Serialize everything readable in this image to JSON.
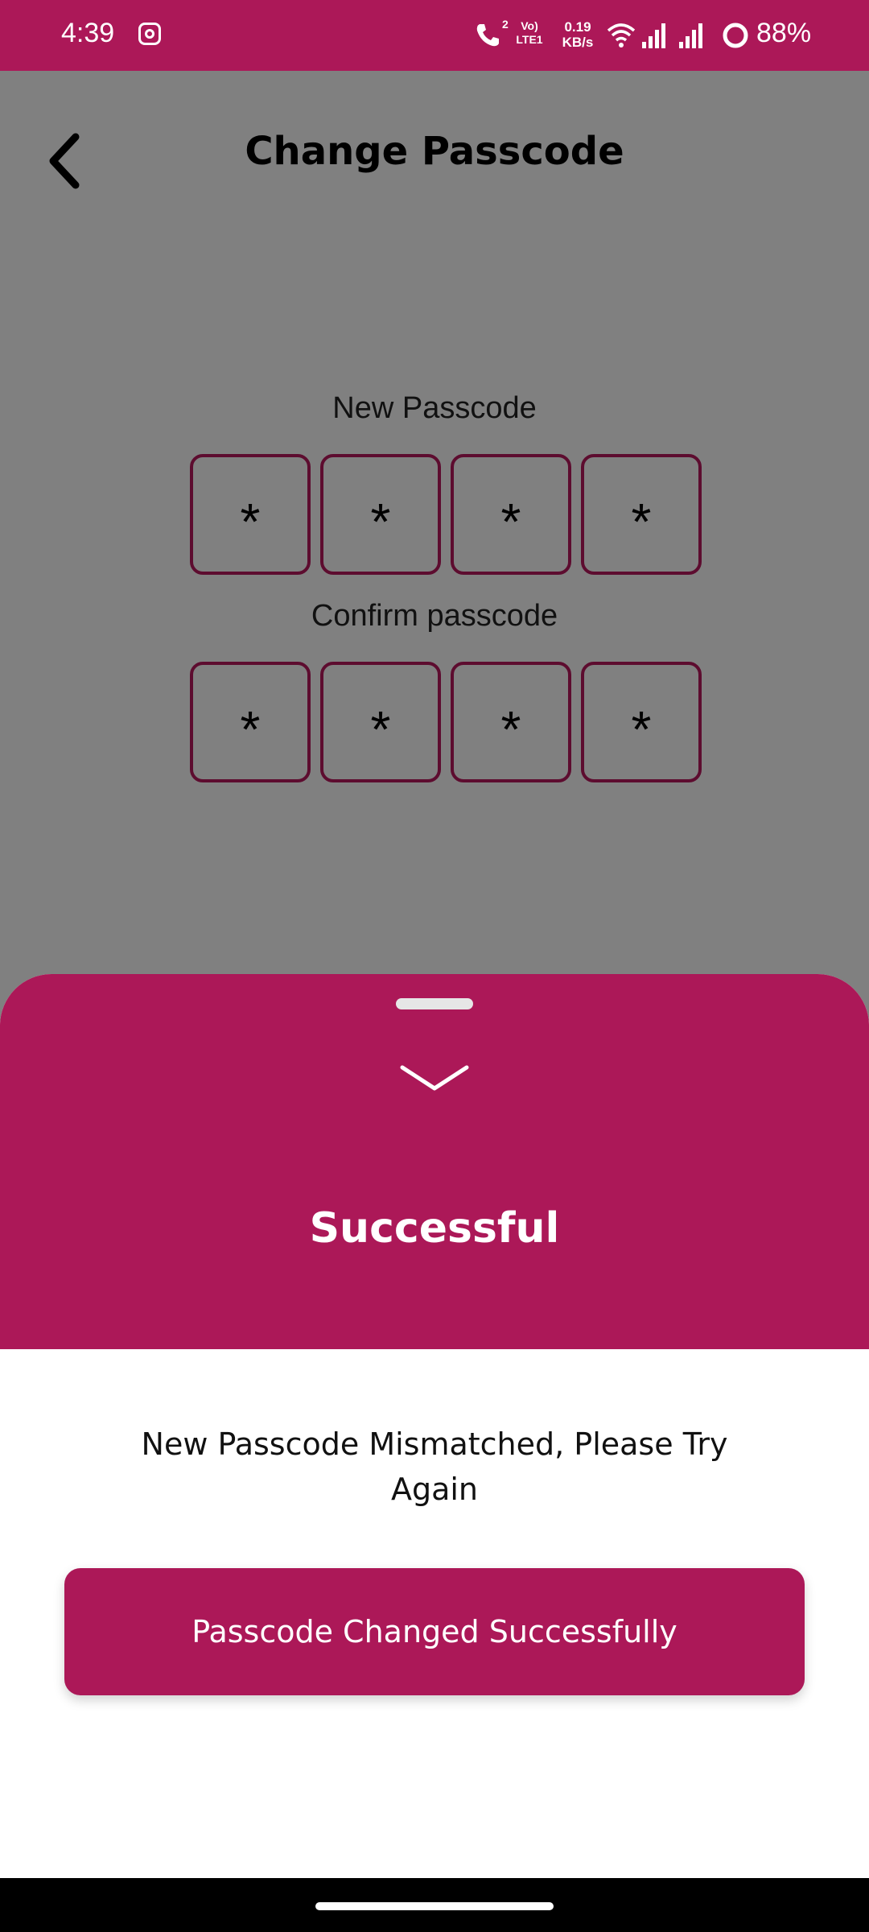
{
  "status_bar": {
    "time": "4:39",
    "network_speed_value": "0.19",
    "network_speed_unit": "KB/s",
    "volte_label": "Vo)",
    "lte_label": "LTE1",
    "battery": "88%"
  },
  "header": {
    "title": "Change Passcode"
  },
  "new_passcode": {
    "label": "New Passcode",
    "digits": [
      "*",
      "*",
      "*",
      "*"
    ]
  },
  "confirm_passcode": {
    "label": "Confirm passcode",
    "digits": [
      "*",
      "*",
      "*",
      "*"
    ]
  },
  "sheet": {
    "title": "Successful",
    "message": "New Passcode Mismatched, Please Try Again"
  },
  "toast": {
    "text": "Passcode Changed Successfully"
  },
  "colors": {
    "accent": "#ac1858",
    "box_border": "#5d0c2f",
    "overlay": "#808080"
  }
}
